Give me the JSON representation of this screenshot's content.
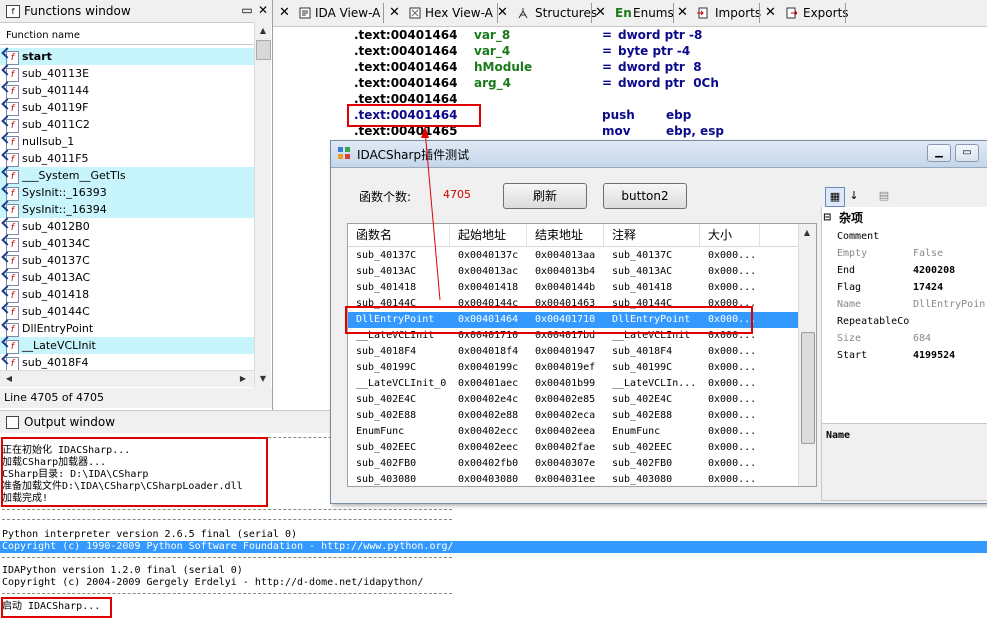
{
  "functions_window": {
    "title": "Functions window",
    "column_header": "Function name",
    "status": "Line 4705 of 4705",
    "items": [
      {
        "name": "start",
        "highlight": true,
        "bold": true
      },
      {
        "name": "sub_40113E",
        "highlight": false,
        "bold": false
      },
      {
        "name": "sub_401144",
        "highlight": false,
        "bold": false
      },
      {
        "name": "sub_40119F",
        "highlight": false,
        "bold": false
      },
      {
        "name": "sub_4011C2",
        "highlight": false,
        "bold": false
      },
      {
        "name": "nullsub_1",
        "highlight": false,
        "bold": false
      },
      {
        "name": "sub_4011F5",
        "highlight": false,
        "bold": false
      },
      {
        "name": "___System__GetTls",
        "highlight": true,
        "bold": false
      },
      {
        "name": "SysInit::_16393",
        "highlight": true,
        "bold": false
      },
      {
        "name": "SysInit::_16394",
        "highlight": true,
        "bold": false
      },
      {
        "name": "sub_4012B0",
        "highlight": false,
        "bold": false
      },
      {
        "name": "sub_40134C",
        "highlight": false,
        "bold": false
      },
      {
        "name": "sub_40137C",
        "highlight": false,
        "bold": false
      },
      {
        "name": "sub_4013AC",
        "highlight": false,
        "bold": false
      },
      {
        "name": "sub_401418",
        "highlight": false,
        "bold": false
      },
      {
        "name": "sub_40144C",
        "highlight": false,
        "bold": false
      },
      {
        "name": "DllEntryPoint",
        "highlight": false,
        "bold": false
      },
      {
        "name": "__LateVCLInit",
        "highlight": true,
        "bold": false
      },
      {
        "name": "sub_4018F4",
        "highlight": false,
        "bold": false
      }
    ]
  },
  "tabs": [
    {
      "label": "IDA View-A",
      "icon": "ida-view-icon"
    },
    {
      "label": "Hex View-A",
      "icon": "hex-view-icon"
    },
    {
      "label": "Structures",
      "icon": "structures-icon"
    },
    {
      "label": "Enums",
      "icon": "enums-icon",
      "icon_text": "En"
    },
    {
      "label": "Imports",
      "icon": "imports-icon"
    },
    {
      "label": "Exports",
      "icon": "exports-icon"
    }
  ],
  "disassembly": [
    {
      "addr": ".text:00401464",
      "name": "var_8",
      "eq": "=",
      "op": "dword ptr -8"
    },
    {
      "addr": ".text:00401464",
      "name": "var_4",
      "eq": "=",
      "op": "byte ptr -4"
    },
    {
      "addr": ".text:00401464",
      "name": "hModule",
      "eq": "=",
      "op": "dword ptr  8"
    },
    {
      "addr": ".text:00401464",
      "name": "arg_4",
      "eq": "=",
      "op": "dword ptr  0Ch"
    },
    {
      "addr": ".text:00401464",
      "name": "",
      "eq": "",
      "op": ""
    },
    {
      "addr": ".text:00401464",
      "name": "",
      "eq": "push",
      "op": "ebp"
    },
    {
      "addr": ".text:00401465",
      "name": "",
      "eq": "mov",
      "op": "ebp, esp"
    }
  ],
  "dialog": {
    "title": "IDACSharp插件测试",
    "count_label": "函数个数:",
    "count_value": "4705",
    "refresh_button": "刷新",
    "button2": "button2",
    "columns": [
      "函数名",
      "起始地址",
      "结束地址",
      "注释",
      "大小"
    ],
    "rows": [
      [
        "sub_40137C",
        "0x0040137c",
        "0x004013aa",
        "sub_40137C",
        "0x000..."
      ],
      [
        "sub_4013AC",
        "0x004013ac",
        "0x004013b4",
        "sub_4013AC",
        "0x000..."
      ],
      [
        "sub_401418",
        "0x00401418",
        "0x0040144b",
        "sub_401418",
        "0x000..."
      ],
      [
        "sub_40144C",
        "0x0040144c",
        "0x00401463",
        "sub_40144C",
        "0x000..."
      ],
      [
        "DllEntryPoint",
        "0x00401464",
        "0x00401710",
        "DllEntryPoint",
        "0x000..."
      ],
      [
        "__LateVCLInit",
        "0x00401710",
        "0x004017bd",
        "__LateVCLInit",
        "0x000..."
      ],
      [
        "sub_4018F4",
        "0x004018f4",
        "0x00401947",
        "sub_4018F4",
        "0x000..."
      ],
      [
        "sub_40199C",
        "0x0040199c",
        "0x004019ef",
        "sub_40199C",
        "0x000..."
      ],
      [
        "__LateVCLInit_0",
        "0x00401aec",
        "0x00401b99",
        "__LateVCLIn...",
        "0x000..."
      ],
      [
        "sub_402E4C",
        "0x00402e4c",
        "0x00402e85",
        "sub_402E4C",
        "0x000..."
      ],
      [
        "sub_402E88",
        "0x00402e88",
        "0x00402eca",
        "sub_402E88",
        "0x000..."
      ],
      [
        "EnumFunc",
        "0x00402ecc",
        "0x00402eea",
        "EnumFunc",
        "0x000..."
      ],
      [
        "sub_402EEC",
        "0x00402eec",
        "0x00402fae",
        "sub_402EEC",
        "0x000..."
      ],
      [
        "sub_402FB0",
        "0x00402fb0",
        "0x0040307e",
        "sub_402FB0",
        "0x000..."
      ],
      [
        "sub_403080",
        "0x00403080",
        "0x004031ee",
        "sub_403080",
        "0x000..."
      ]
    ],
    "selected_row": 4,
    "property_grid": {
      "category": "杂项",
      "rows": [
        {
          "key": "Comment",
          "value": "",
          "dim": false,
          "bold": false
        },
        {
          "key": "Empty",
          "value": "False",
          "dim": true,
          "bold": false
        },
        {
          "key": "End",
          "value": "4200208",
          "dim": false,
          "bold": true
        },
        {
          "key": "Flag",
          "value": "17424",
          "dim": false,
          "bold": true
        },
        {
          "key": "Name",
          "value": "DllEntryPoin",
          "dim": true,
          "bold": false
        },
        {
          "key": "RepeatableCo",
          "value": "",
          "dim": false,
          "bold": false
        },
        {
          "key": "Size",
          "value": "684",
          "dim": true,
          "bold": false
        },
        {
          "key": "Start",
          "value": "4199524",
          "dim": false,
          "bold": true
        }
      ],
      "description_title": "Name"
    }
  },
  "output_window": {
    "title": "Output window",
    "lines": [
      {
        "text": "正在初始化 IDACSharp...",
        "style": "normal"
      },
      {
        "text": "加载CSharp加载器...",
        "style": "normal"
      },
      {
        "text": "CSharp目录: D:\\IDA\\CSharp",
        "style": "normal"
      },
      {
        "text": "准备加载文件D:\\IDA\\CSharp\\CSharpLoader.dll",
        "style": "normal"
      },
      {
        "text": "加载完成!",
        "style": "normal"
      },
      {
        "text": "Python interpreter version 2.6.5 final (serial 0)",
        "style": "normal"
      },
      {
        "text": "Copyright (c) 1990-2009 Python Software Foundation - http://www.python.org/",
        "style": "selected"
      },
      {
        "text": "IDAPython version 1.2.0 final (serial 0)",
        "style": "normal"
      },
      {
        "text": "Copyright (c) 2004-2009 Gergely Erdelyi - http://d-dome.net/idapython/",
        "style": "normal"
      },
      {
        "text": "启动 IDACSharp...",
        "style": "normal"
      }
    ]
  },
  "colors": {
    "highlight_row": "#c8f4fc",
    "selection": "#3399ff",
    "annotation_red": "#e00000"
  }
}
